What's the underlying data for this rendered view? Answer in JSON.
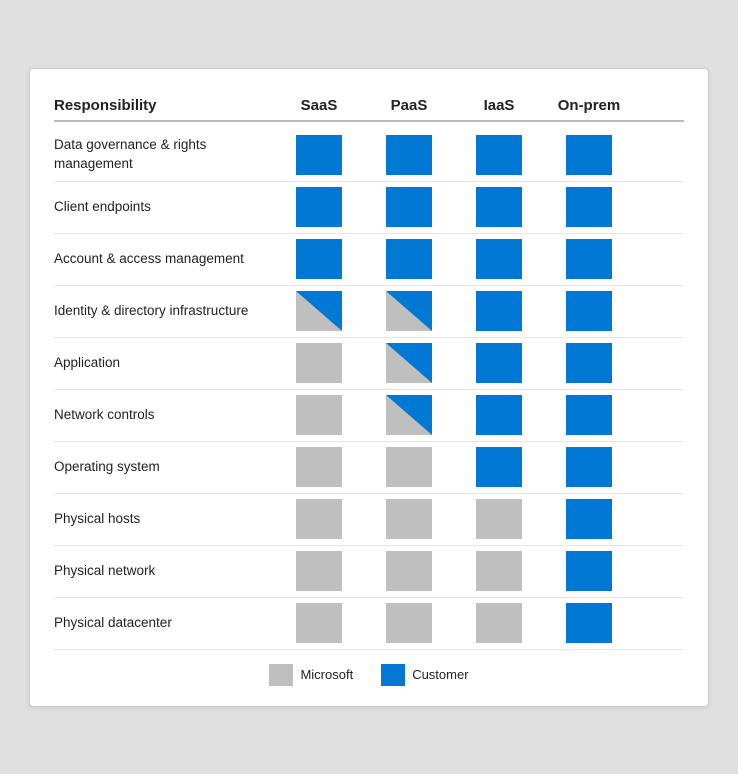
{
  "header": {
    "col_responsibility": "Responsibility",
    "col_saas": "SaaS",
    "col_paas": "PaaS",
    "col_iaas": "IaaS",
    "col_onprem": "On-prem"
  },
  "rows": [
    {
      "label": "Data governance & rights management",
      "saas": "blue",
      "paas": "blue",
      "iaas": "blue",
      "onprem": "blue"
    },
    {
      "label": "Client endpoints",
      "saas": "blue",
      "paas": "blue",
      "iaas": "blue",
      "onprem": "blue"
    },
    {
      "label": "Account & access management",
      "saas": "blue",
      "paas": "blue",
      "iaas": "blue",
      "onprem": "blue"
    },
    {
      "label": "Identity & directory infrastructure",
      "saas": "half",
      "paas": "half",
      "iaas": "blue",
      "onprem": "blue"
    },
    {
      "label": "Application",
      "saas": "gray",
      "paas": "half",
      "iaas": "blue",
      "onprem": "blue"
    },
    {
      "label": "Network controls",
      "saas": "gray",
      "paas": "half",
      "iaas": "blue",
      "onprem": "blue"
    },
    {
      "label": "Operating system",
      "saas": "gray",
      "paas": "gray",
      "iaas": "blue",
      "onprem": "blue"
    },
    {
      "label": "Physical hosts",
      "saas": "gray",
      "paas": "gray",
      "iaas": "gray",
      "onprem": "blue"
    },
    {
      "label": "Physical network",
      "saas": "gray",
      "paas": "gray",
      "iaas": "gray",
      "onprem": "blue"
    },
    {
      "label": "Physical datacenter",
      "saas": "gray",
      "paas": "gray",
      "iaas": "gray",
      "onprem": "blue"
    }
  ],
  "legend": {
    "microsoft_label": "Microsoft",
    "customer_label": "Customer"
  }
}
